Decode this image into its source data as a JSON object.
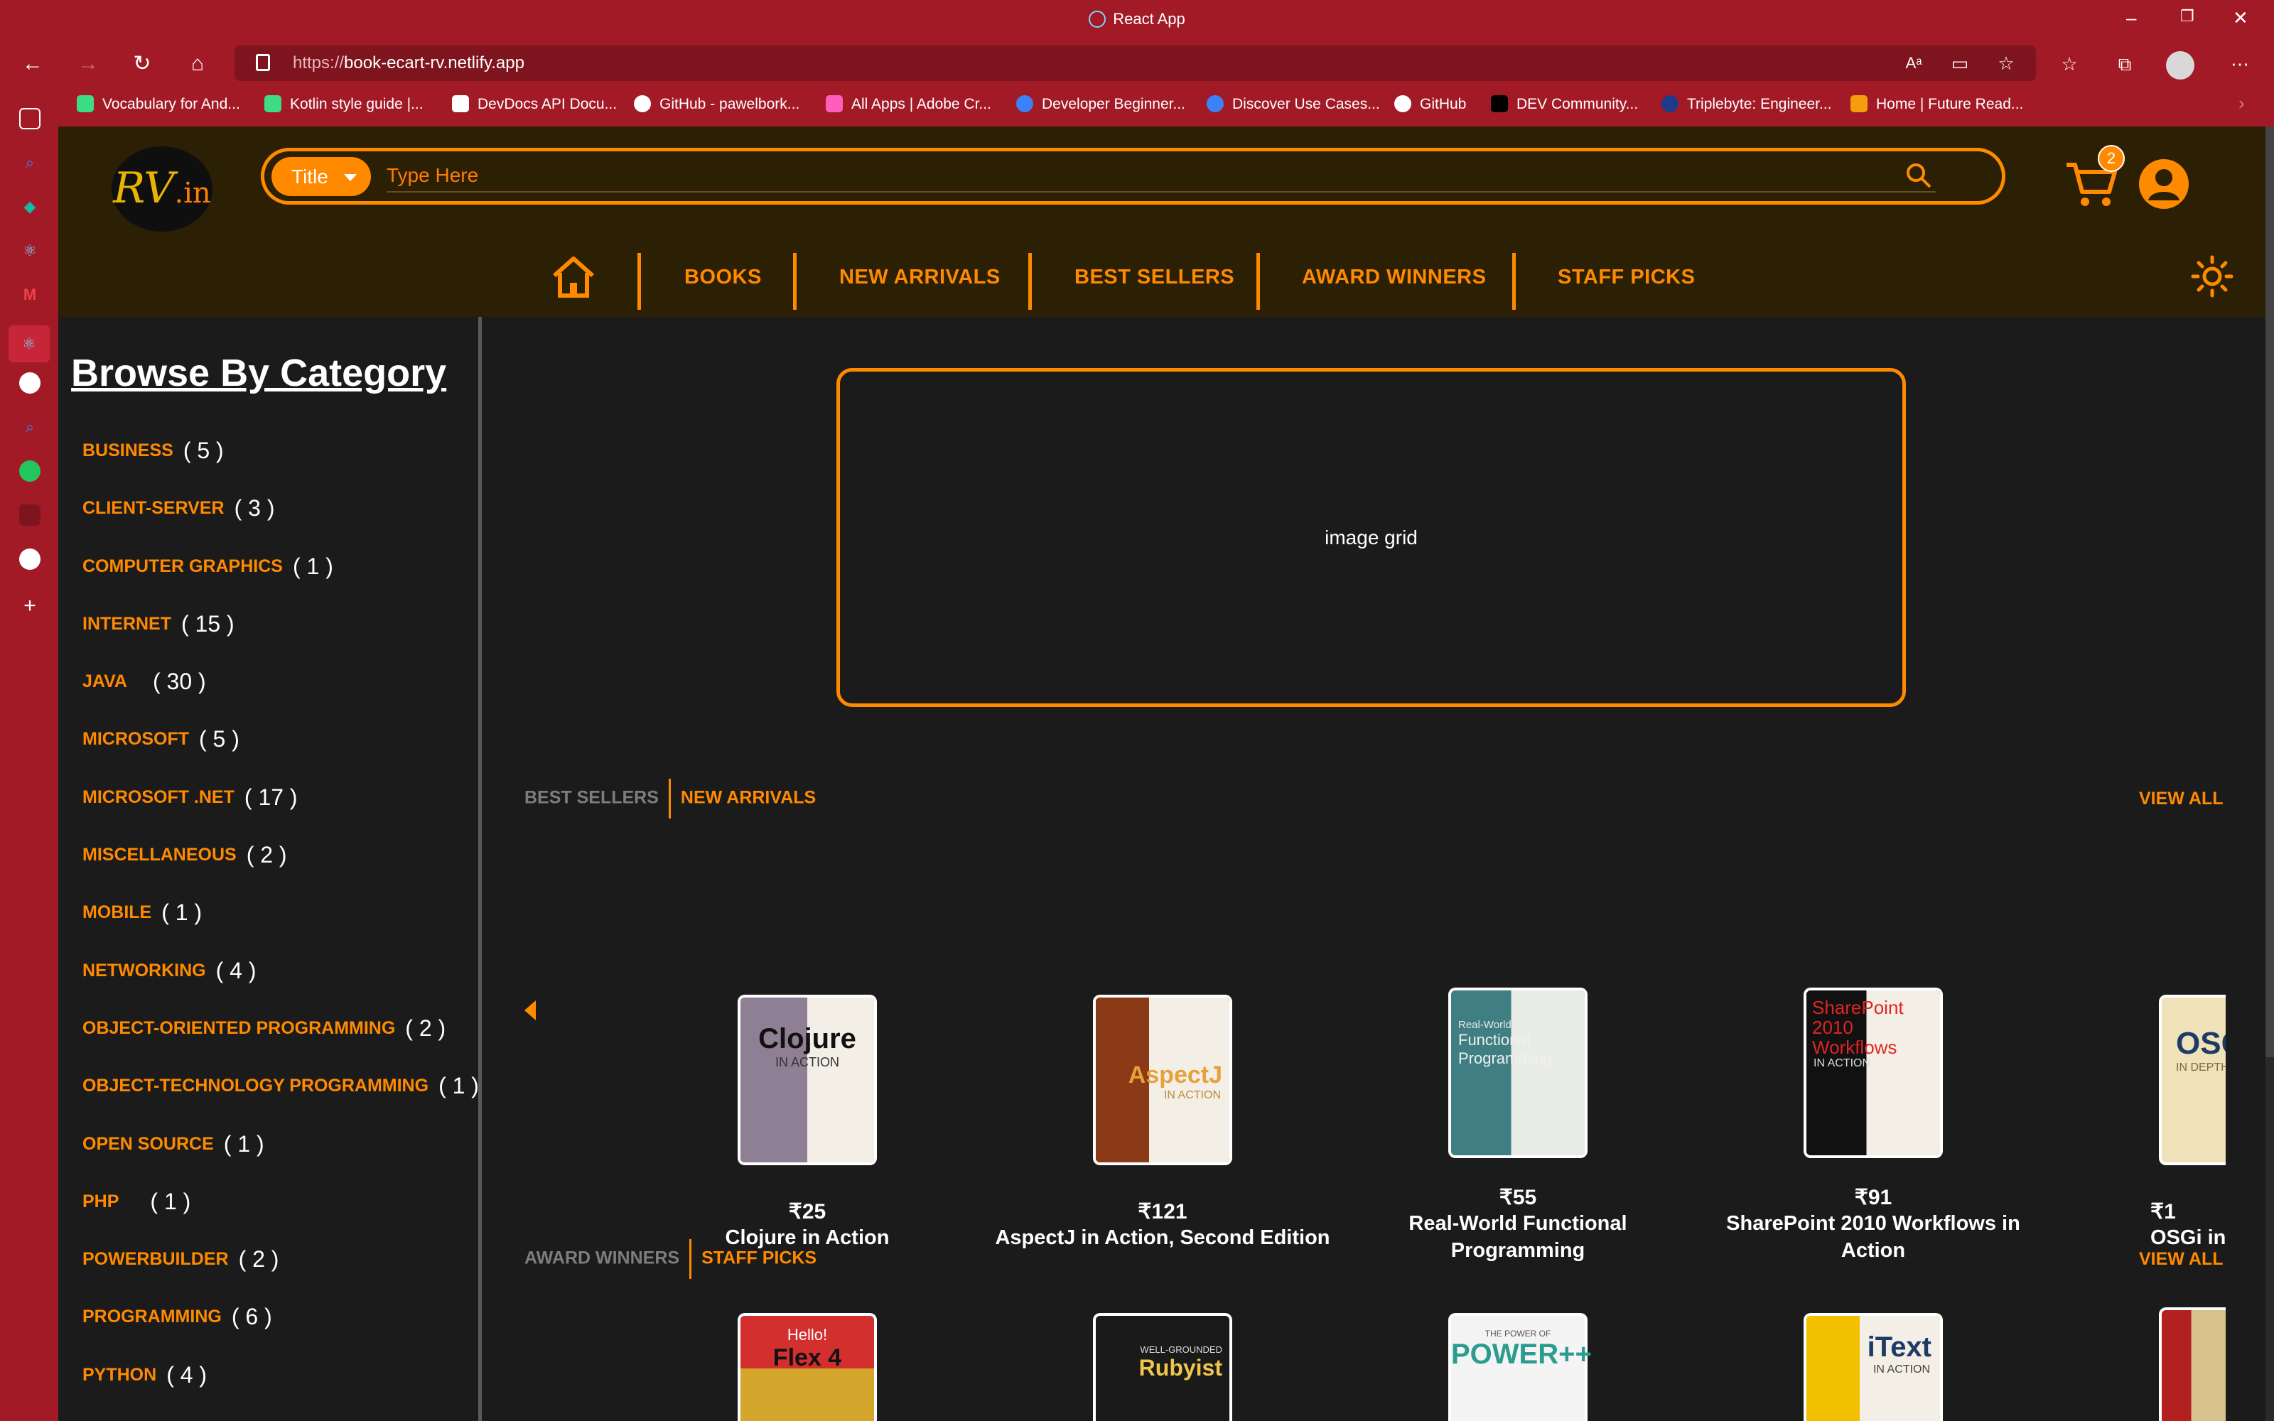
{
  "browser": {
    "window_title": "React App",
    "url_prefix": "https://",
    "url_host": "book-ecart-rv.netlify.app",
    "bookmarks": [
      {
        "label": "Vocabulary for And...",
        "icon": "android-icon",
        "color": "#3ddc84"
      },
      {
        "label": "Kotlin style guide |...",
        "icon": "android-icon",
        "color": "#3ddc84"
      },
      {
        "label": "DevDocs API Docu...",
        "icon": "devdocs-icon",
        "color": "#ffffff"
      },
      {
        "label": "GitHub - pawelbork...",
        "icon": "github-icon",
        "color": "#ffffff"
      },
      {
        "label": "All Apps | Adobe Cr...",
        "icon": "adobe-icon",
        "color": "#ff5ebc"
      },
      {
        "label": "Developer Beginner...",
        "icon": "dev-beginner-icon",
        "color": "#3b82f6"
      },
      {
        "label": "Discover Use Cases...",
        "icon": "discover-icon",
        "color": "#3b82f6"
      },
      {
        "label": "GitHub",
        "icon": "github-icon",
        "color": "#ffffff"
      },
      {
        "label": "DEV Community...",
        "icon": "dev-icon",
        "color": "#000000"
      },
      {
        "label": "Triplebyte: Engineer...",
        "icon": "triplebyte-icon",
        "color": "#1e3a8a"
      },
      {
        "label": "Home | Future Read...",
        "icon": "future-icon",
        "color": "#f59e0b"
      }
    ]
  },
  "header": {
    "logo_main": "RV",
    "logo_suffix": ".in",
    "search_type": "Title",
    "search_placeholder": "Type Here",
    "cart_count": "2"
  },
  "nav": {
    "items": [
      "BOOKS",
      "NEW ARRIVALS",
      "BEST SELLERS",
      "AWARD WINNERS",
      "STAFF PICKS"
    ]
  },
  "categories": {
    "heading": "Browse By Category",
    "items": [
      {
        "name": "BUSINESS",
        "count": "( 5 )"
      },
      {
        "name": "CLIENT-SERVER",
        "count": "( 3 )"
      },
      {
        "name": "COMPUTER GRAPHICS",
        "count": "( 1 )"
      },
      {
        "name": "INTERNET",
        "count": "( 15 )"
      },
      {
        "name": "JAVA",
        "count": "( 30 )"
      },
      {
        "name": "MICROSOFT",
        "count": "( 5 )"
      },
      {
        "name": "MICROSOFT .NET",
        "count": "( 17 )"
      },
      {
        "name": "MISCELLANEOUS",
        "count": "( 2 )"
      },
      {
        "name": "MOBILE",
        "count": "( 1 )"
      },
      {
        "name": "NETWORKING",
        "count": "( 4 )"
      },
      {
        "name": "OBJECT-ORIENTED PROGRAMMING",
        "count": "( 2 )"
      },
      {
        "name": "OBJECT-TECHNOLOGY PROGRAMMING",
        "count": "( 1 )"
      },
      {
        "name": "OPEN SOURCE",
        "count": "( 1 )"
      },
      {
        "name": "PHP",
        "count": "( 1 )"
      },
      {
        "name": "POWERBUILDER",
        "count": "( 2 )"
      },
      {
        "name": "PROGRAMMING",
        "count": "( 6 )"
      },
      {
        "name": "PYTHON",
        "count": "( 4 )"
      }
    ]
  },
  "banner": {
    "text": "image grid"
  },
  "section1": {
    "tab_inactive": "BEST SELLERS",
    "tab_active": "NEW ARRIVALS",
    "view_all": "VIEW ALL",
    "books": [
      {
        "price": "₹25",
        "title": "Clojure in Action",
        "cover_text": "Clojure",
        "cover_sub": "IN ACTION",
        "cover_color": "#8f7f94"
      },
      {
        "price": "₹121",
        "title": "AspectJ in Action, Second Edition",
        "cover_text": "AspectJ",
        "cover_sub": "IN ACTION",
        "cover_color": "#8a3a16"
      },
      {
        "price": "₹55",
        "title": "Real-World Functional Programming",
        "cover_text": "Functional Programming",
        "cover_sub": "Real-World",
        "cover_color": "#3f7f83"
      },
      {
        "price": "₹91",
        "title": "SharePoint 2010 Workflows in Action",
        "cover_text": "SharePoint 2010 Workflows",
        "cover_sub": "IN ACTION",
        "cover_color": "#1a1a1a"
      },
      {
        "price": "₹1",
        "title": "OSGi in",
        "cover_text": "OSGi",
        "cover_sub": "IN DEPTH",
        "cover_color": "#efe2b8"
      }
    ]
  },
  "section2": {
    "tab_inactive": "AWARD WINNERS",
    "tab_active": "STAFF PICKS",
    "view_all": "VIEW ALL",
    "books": [
      {
        "cover_text": "Flex 4",
        "cover_sub": "Hello!",
        "cover_color": "#d4a72c"
      },
      {
        "cover_text": "Rubyist",
        "cover_sub": "WELL-GROUNDED",
        "cover_color": "#1a1a1a"
      },
      {
        "cover_text": "POWER++",
        "cover_sub": "THE POWER OF",
        "cover_color": "#f4f4f4"
      },
      {
        "cover_text": "iText",
        "cover_sub": "IN ACTION",
        "cover_color": "#f2c000"
      },
      {
        "cover_text": "",
        "cover_sub": "",
        "cover_color": "#d8c18a"
      }
    ]
  }
}
